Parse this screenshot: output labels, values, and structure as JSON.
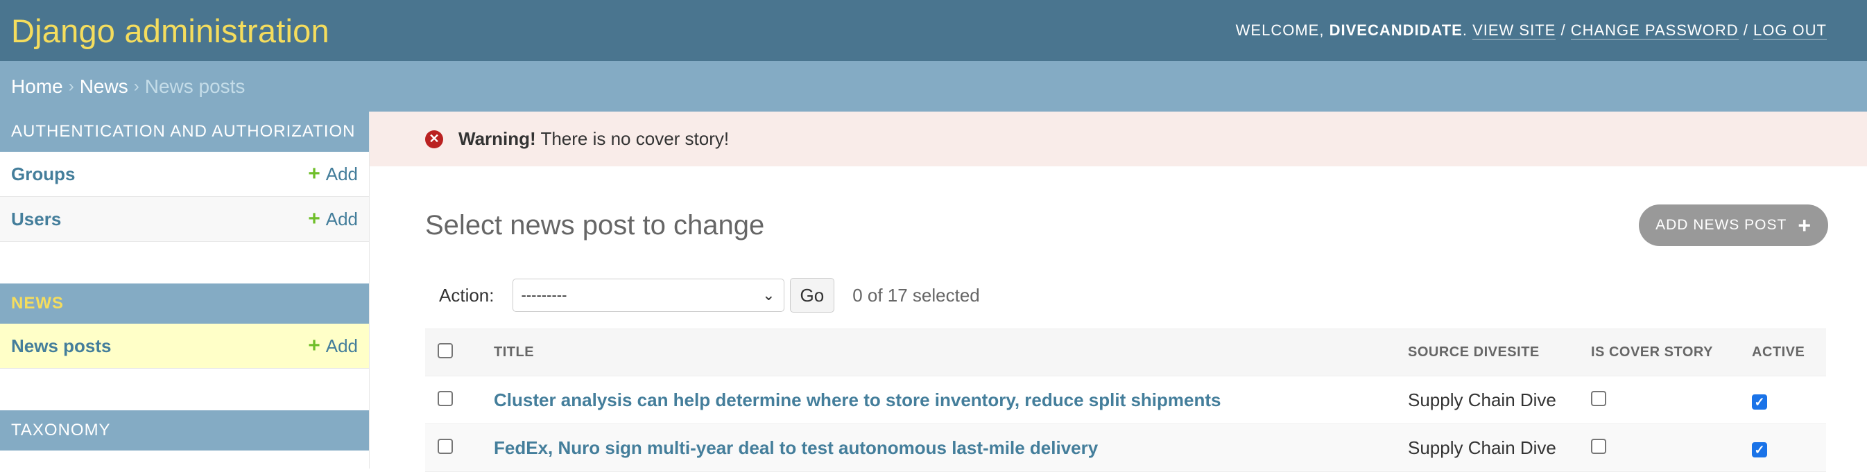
{
  "header": {
    "site_name": "Django administration",
    "welcome": "WELCOME,",
    "username": "DIVECANDIDATE",
    "view_site": "VIEW SITE",
    "change_password": "CHANGE PASSWORD",
    "log_out": "LOG OUT"
  },
  "breadcrumbs": {
    "home": "Home",
    "news": "News",
    "current": "News posts",
    "sep": "›"
  },
  "sidebar": {
    "auth_caption": "AUTHENTICATION AND AUTHORIZATION",
    "groups": "Groups",
    "users": "Users",
    "add": "Add",
    "news_caption": "NEWS",
    "news_posts": "News posts",
    "taxonomy_caption": "TAXONOMY"
  },
  "messages": {
    "warning_bold": "Warning!",
    "warning_text": " There is no cover story!"
  },
  "content": {
    "title": "Select news post to change",
    "add_button": "ADD NEWS POST",
    "action_label": "Action:",
    "action_selected": "---------",
    "go": "Go",
    "counter": "0 of 17 selected",
    "columns": {
      "title": "TITLE",
      "source": "SOURCE DIVESITE",
      "cover": "IS COVER STORY",
      "active": "ACTIVE"
    },
    "rows": [
      {
        "title": "Cluster analysis can help determine where to store inventory, reduce split shipments",
        "source": "Supply Chain Dive",
        "is_cover_story": false,
        "active": true
      },
      {
        "title": "FedEx, Nuro sign multi-year deal to test autonomous last-mile delivery",
        "source": "Supply Chain Dive",
        "is_cover_story": false,
        "active": true
      }
    ]
  },
  "colors": {
    "header": "#4a758f",
    "breadcrumbs": "#84abc4",
    "accent_yellow": "#f5dd5d",
    "link": "#447e9b",
    "add_green": "#70bf2b",
    "warning_bg": "#f9ece9"
  }
}
